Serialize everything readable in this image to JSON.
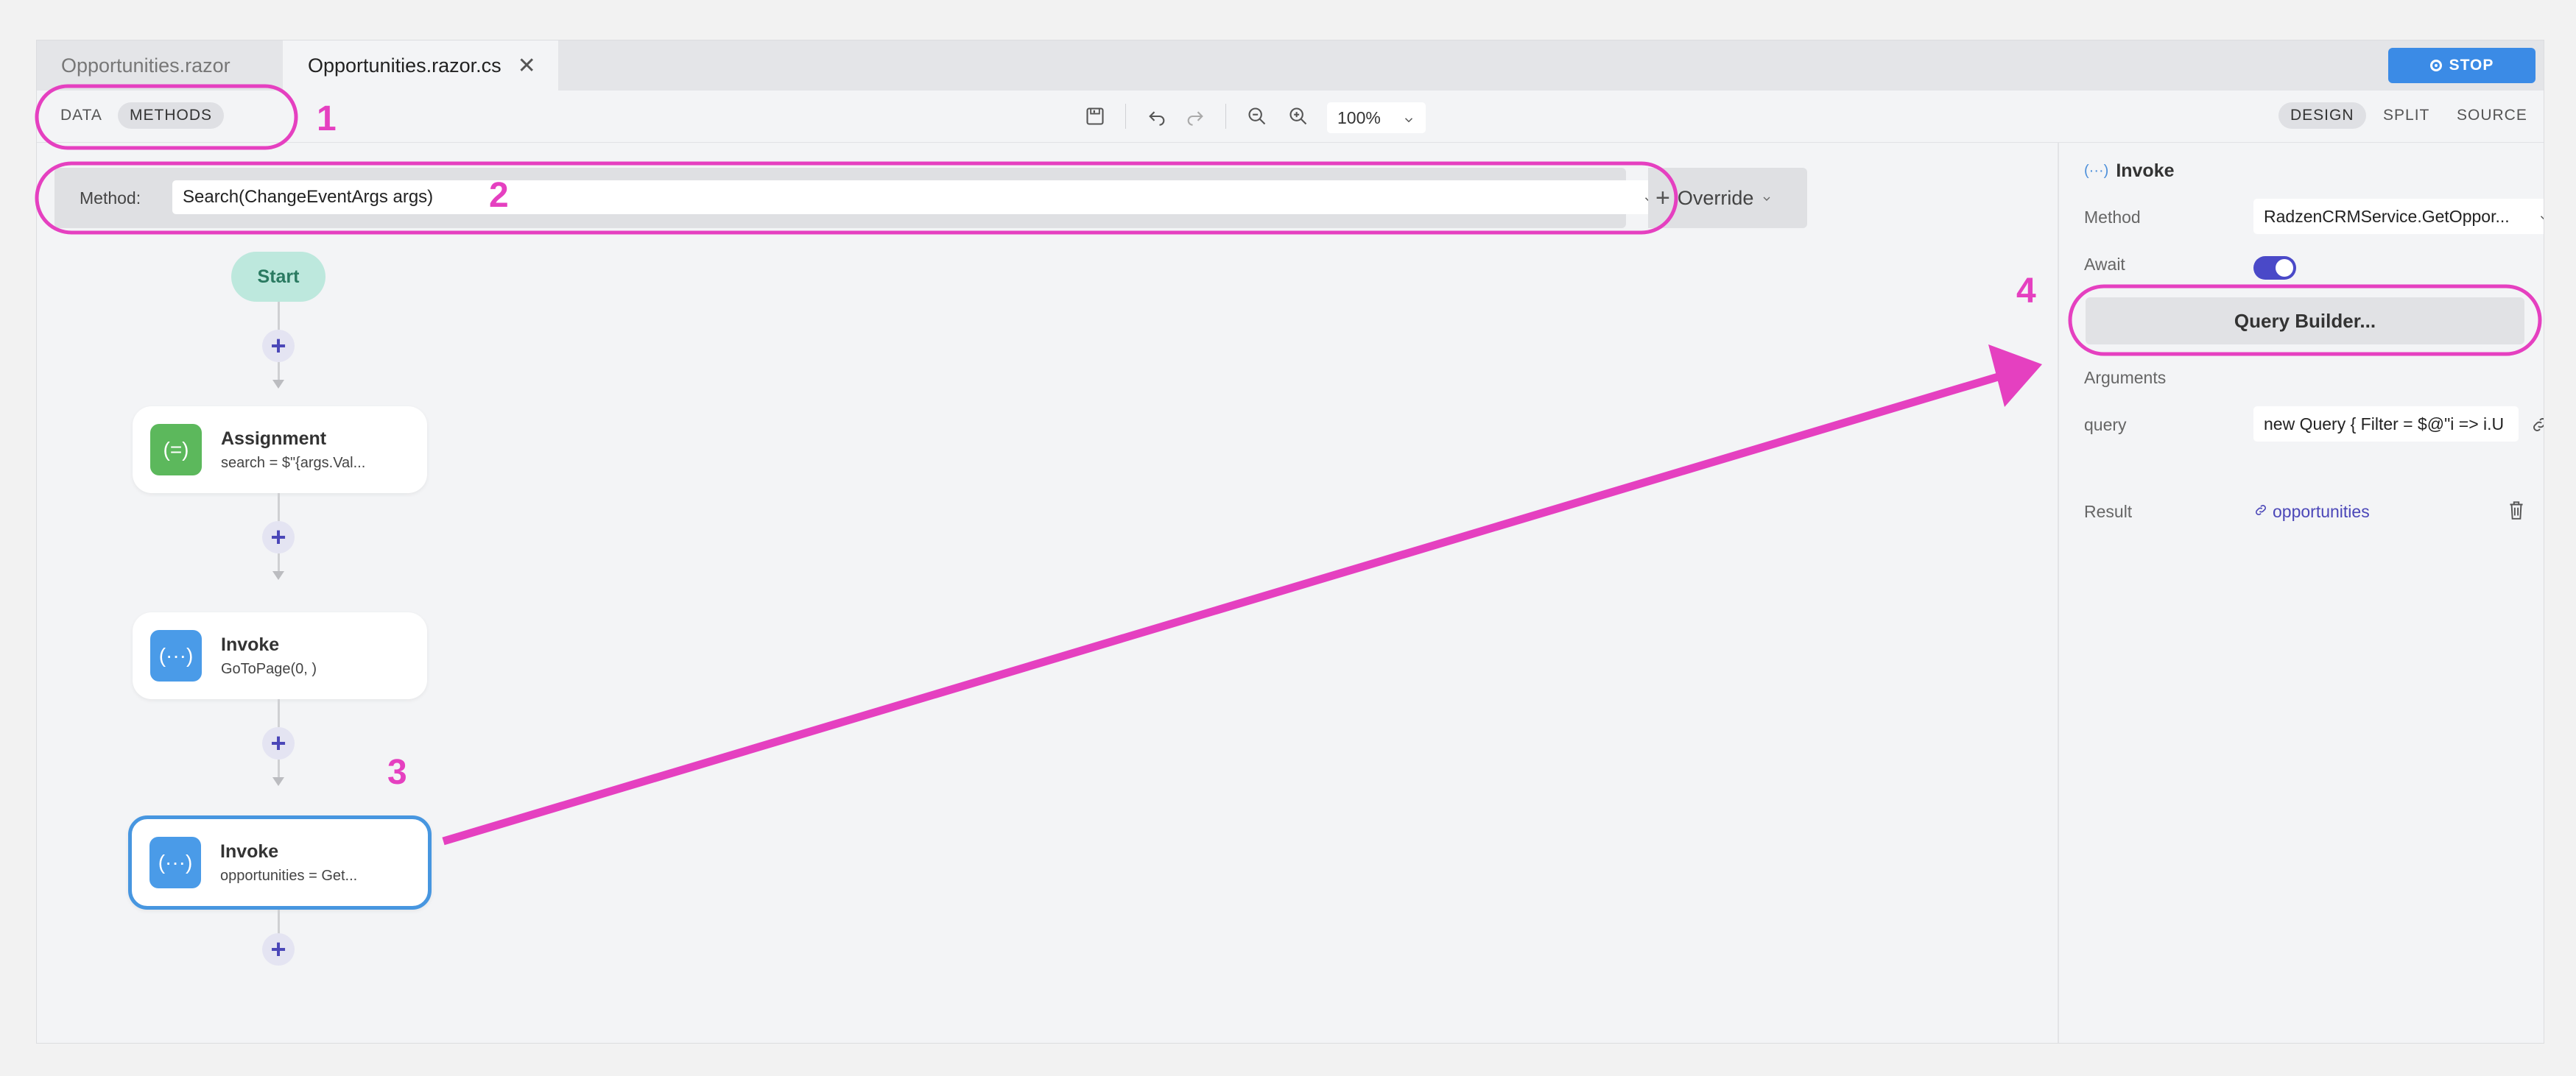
{
  "tabs": [
    {
      "label": "Opportunities.razor"
    },
    {
      "label": "Opportunities.razor.cs"
    }
  ],
  "stop_label": "STOP",
  "toolbar": {
    "data_label": "DATA",
    "methods_label": "METHODS",
    "zoom": "100%",
    "design_label": "DESIGN",
    "split_label": "SPLIT",
    "source_label": "SOURCE"
  },
  "method_bar": {
    "label": "Method:",
    "value": "Search(ChangeEventArgs args)",
    "override_label": "Override"
  },
  "flow": {
    "start_label": "Start",
    "nodes": [
      {
        "title": "Assignment",
        "subtitle": "search = $\"{args.Val...",
        "icon": "assignment-icon",
        "color": "#5cb85c"
      },
      {
        "title": "Invoke",
        "subtitle": "GoToPage(0, )",
        "icon": "invoke-icon",
        "color": "#4a9be8"
      },
      {
        "title": "Invoke",
        "subtitle": "opportunities = Get...",
        "icon": "invoke-icon",
        "color": "#4a9be8"
      }
    ]
  },
  "properties": {
    "title": "Invoke",
    "method_label": "Method",
    "method_value": "RadzenCRMService.GetOppor...",
    "await_label": "Await",
    "await_on": true,
    "query_builder_label": "Query Builder...",
    "arguments_label": "Arguments",
    "query_label": "query",
    "query_value": "new Query { Filter = $@\"i => i.U",
    "result_label": "Result",
    "result_value": "opportunities"
  },
  "annotations": [
    "1",
    "2",
    "3",
    "4"
  ],
  "colors": {
    "annotation": "#e540c0",
    "accent": "#3b8be6",
    "toggle": "#4a49c8"
  }
}
